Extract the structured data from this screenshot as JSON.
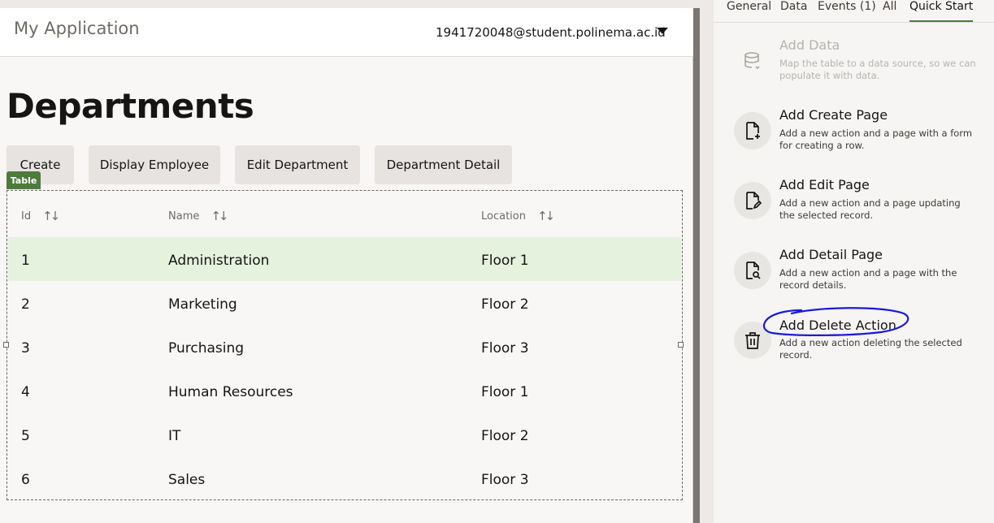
{
  "app": {
    "title": "My Application",
    "user_email": "1941720048@student.polinema.ac.id"
  },
  "page": {
    "heading": "Departments"
  },
  "toolbar": {
    "create_label": "Create",
    "display_employee_label": "Display Employee",
    "edit_department_label": "Edit Department",
    "department_detail_label": "Department Detail"
  },
  "table": {
    "badge": "Table",
    "columns": [
      "Id",
      "Name",
      "Location"
    ],
    "rows": [
      {
        "id": "1",
        "name": "Administration",
        "location": "Floor 1"
      },
      {
        "id": "2",
        "name": "Marketing",
        "location": "Floor 2"
      },
      {
        "id": "3",
        "name": "Purchasing",
        "location": "Floor 3"
      },
      {
        "id": "4",
        "name": "Human Resources",
        "location": "Floor 1"
      },
      {
        "id": "5",
        "name": "IT",
        "location": "Floor 2"
      },
      {
        "id": "6",
        "name": "Sales",
        "location": "Floor 3"
      }
    ],
    "selected_row": "1"
  },
  "panel": {
    "tabs": [
      "General",
      "Data",
      "Events (1)",
      "All",
      "Quick Start"
    ],
    "active_tab": "Quick Start",
    "quick_start": [
      {
        "title": "Add Data",
        "desc": "Map the table to a data source, so we can populate it with data.",
        "icon": "database-icon",
        "enabled": false
      },
      {
        "title": "Add Create Page",
        "desc": "Add a new action and a page with a form for creating a row.",
        "icon": "page-add-icon",
        "enabled": true
      },
      {
        "title": "Add Edit Page",
        "desc": "Add a new action and a page updating the selected record.",
        "icon": "page-edit-icon",
        "enabled": true
      },
      {
        "title": "Add Detail Page",
        "desc": "Add a new action and a page with the record details.",
        "icon": "page-search-icon",
        "enabled": true
      },
      {
        "title": "Add Delete Action",
        "desc": "Add a new action deleting the selected record.",
        "icon": "trash-icon",
        "enabled": true
      }
    ]
  },
  "colors": {
    "accent_green": "#4e7b3d",
    "selected_row": "#e4f2de",
    "annotation_blue": "#1a1adb"
  }
}
